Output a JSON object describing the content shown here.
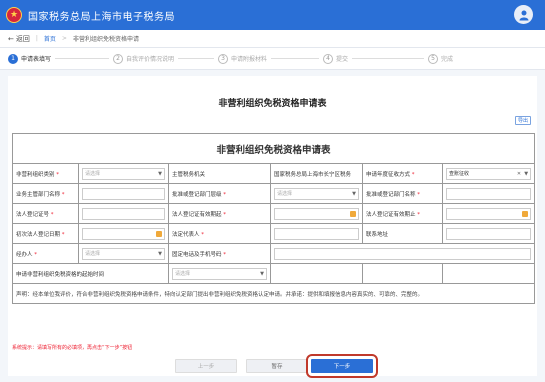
{
  "header": {
    "title": "国家税务总局上海市电子税务局"
  },
  "breadcrumb": {
    "back": "返回",
    "home": "首页",
    "current": "非营利组织免税资格申请"
  },
  "steps": [
    {
      "num": "1",
      "label": "申请表填写"
    },
    {
      "num": "2",
      "label": "自我评价情况说明"
    },
    {
      "num": "3",
      "label": "申请附报材料"
    },
    {
      "num": "4",
      "label": "提交"
    },
    {
      "num": "5",
      "label": "完成"
    }
  ],
  "page_title": "非营利组织免税资格申请表",
  "print_label": "导出",
  "table": {
    "caption": "非营利组织免税资格申请表",
    "org_type_label": "非营利组织类别",
    "org_type_placeholder": "请选择",
    "tax_authority_label": "主管税务机关",
    "tax_authority_value": "国家税务总局上海市长宁区税务",
    "levy_method_label": "申请年度征收方式",
    "levy_method_value": "查账征收",
    "dept_name_label": "业务主管部门名称",
    "approval_level_label": "批准或登记部门层级",
    "approval_level_placeholder": "请选择",
    "approval_name_label": "批准或登记部门名称",
    "legal_cert_label": "法人登记证号",
    "legal_start_label": "法人登记证有效期起",
    "legal_end_label": "法人登记证有效期止",
    "first_reg_date_label": "初次法人登记日期",
    "legal_rep_label": "法定代表人",
    "contact_addr_label": "联系地址",
    "handler_label": "经办人",
    "handler_placeholder": "请选择",
    "phone_label": "固定电话及手机号码",
    "apply_year_label": "申请非营利组织免税资格的起始时间",
    "apply_year_placeholder": "请选择",
    "statement": "声明：经本单位我评价，符合非营利组织免税资格申请条件，特向认定部门提出非营利组织免税资格认定申请。并承诺：提供和填报信息内容真实的、可靠的、完整的。"
  },
  "tip": "系统提示：请填写所有的必填项，再点击“下一步”按钮",
  "buttons": {
    "prev": "上一步",
    "save": "暂存",
    "next": "下一步"
  }
}
